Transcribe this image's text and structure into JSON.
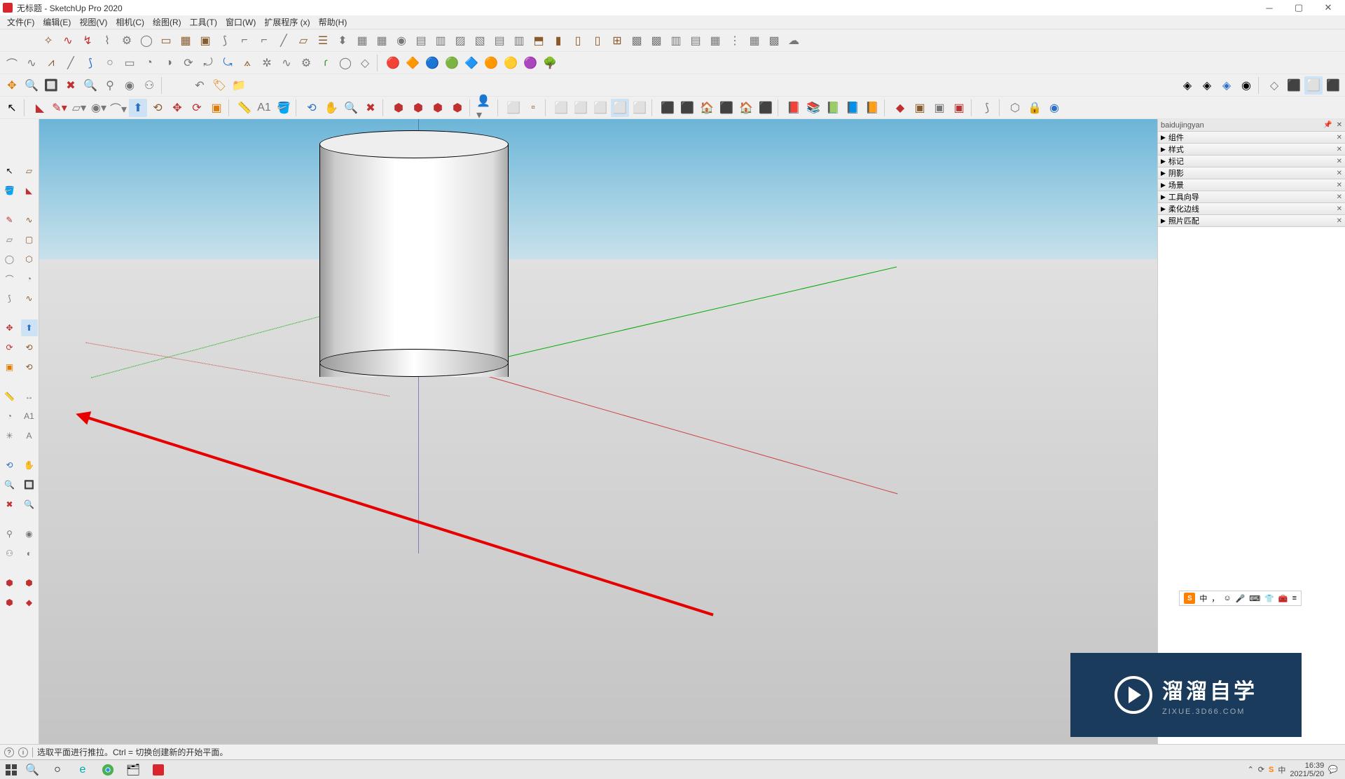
{
  "title": "无标题 - SketchUp Pro 2020",
  "menu": [
    "文件(F)",
    "编辑(E)",
    "视图(V)",
    "相机(C)",
    "绘图(R)",
    "工具(T)",
    "窗口(W)",
    "扩展程序 (x)",
    "帮助(H)"
  ],
  "right_panel": {
    "header": "baidujingyan",
    "sections": [
      "组件",
      "样式",
      "标记",
      "阴影",
      "场景",
      "工具向导",
      "柔化边线",
      "照片匹配"
    ]
  },
  "status": {
    "hint": "选取平面进行推拉。Ctrl = 切换创建新的开始平面。"
  },
  "ime": {
    "lang": "中",
    "punct": "，"
  },
  "watermark": {
    "text": "溜溜自学",
    "sub": "ZIXUE.3D66.COM"
  },
  "clock": {
    "time": "16:39",
    "date": "2021/5/20"
  }
}
